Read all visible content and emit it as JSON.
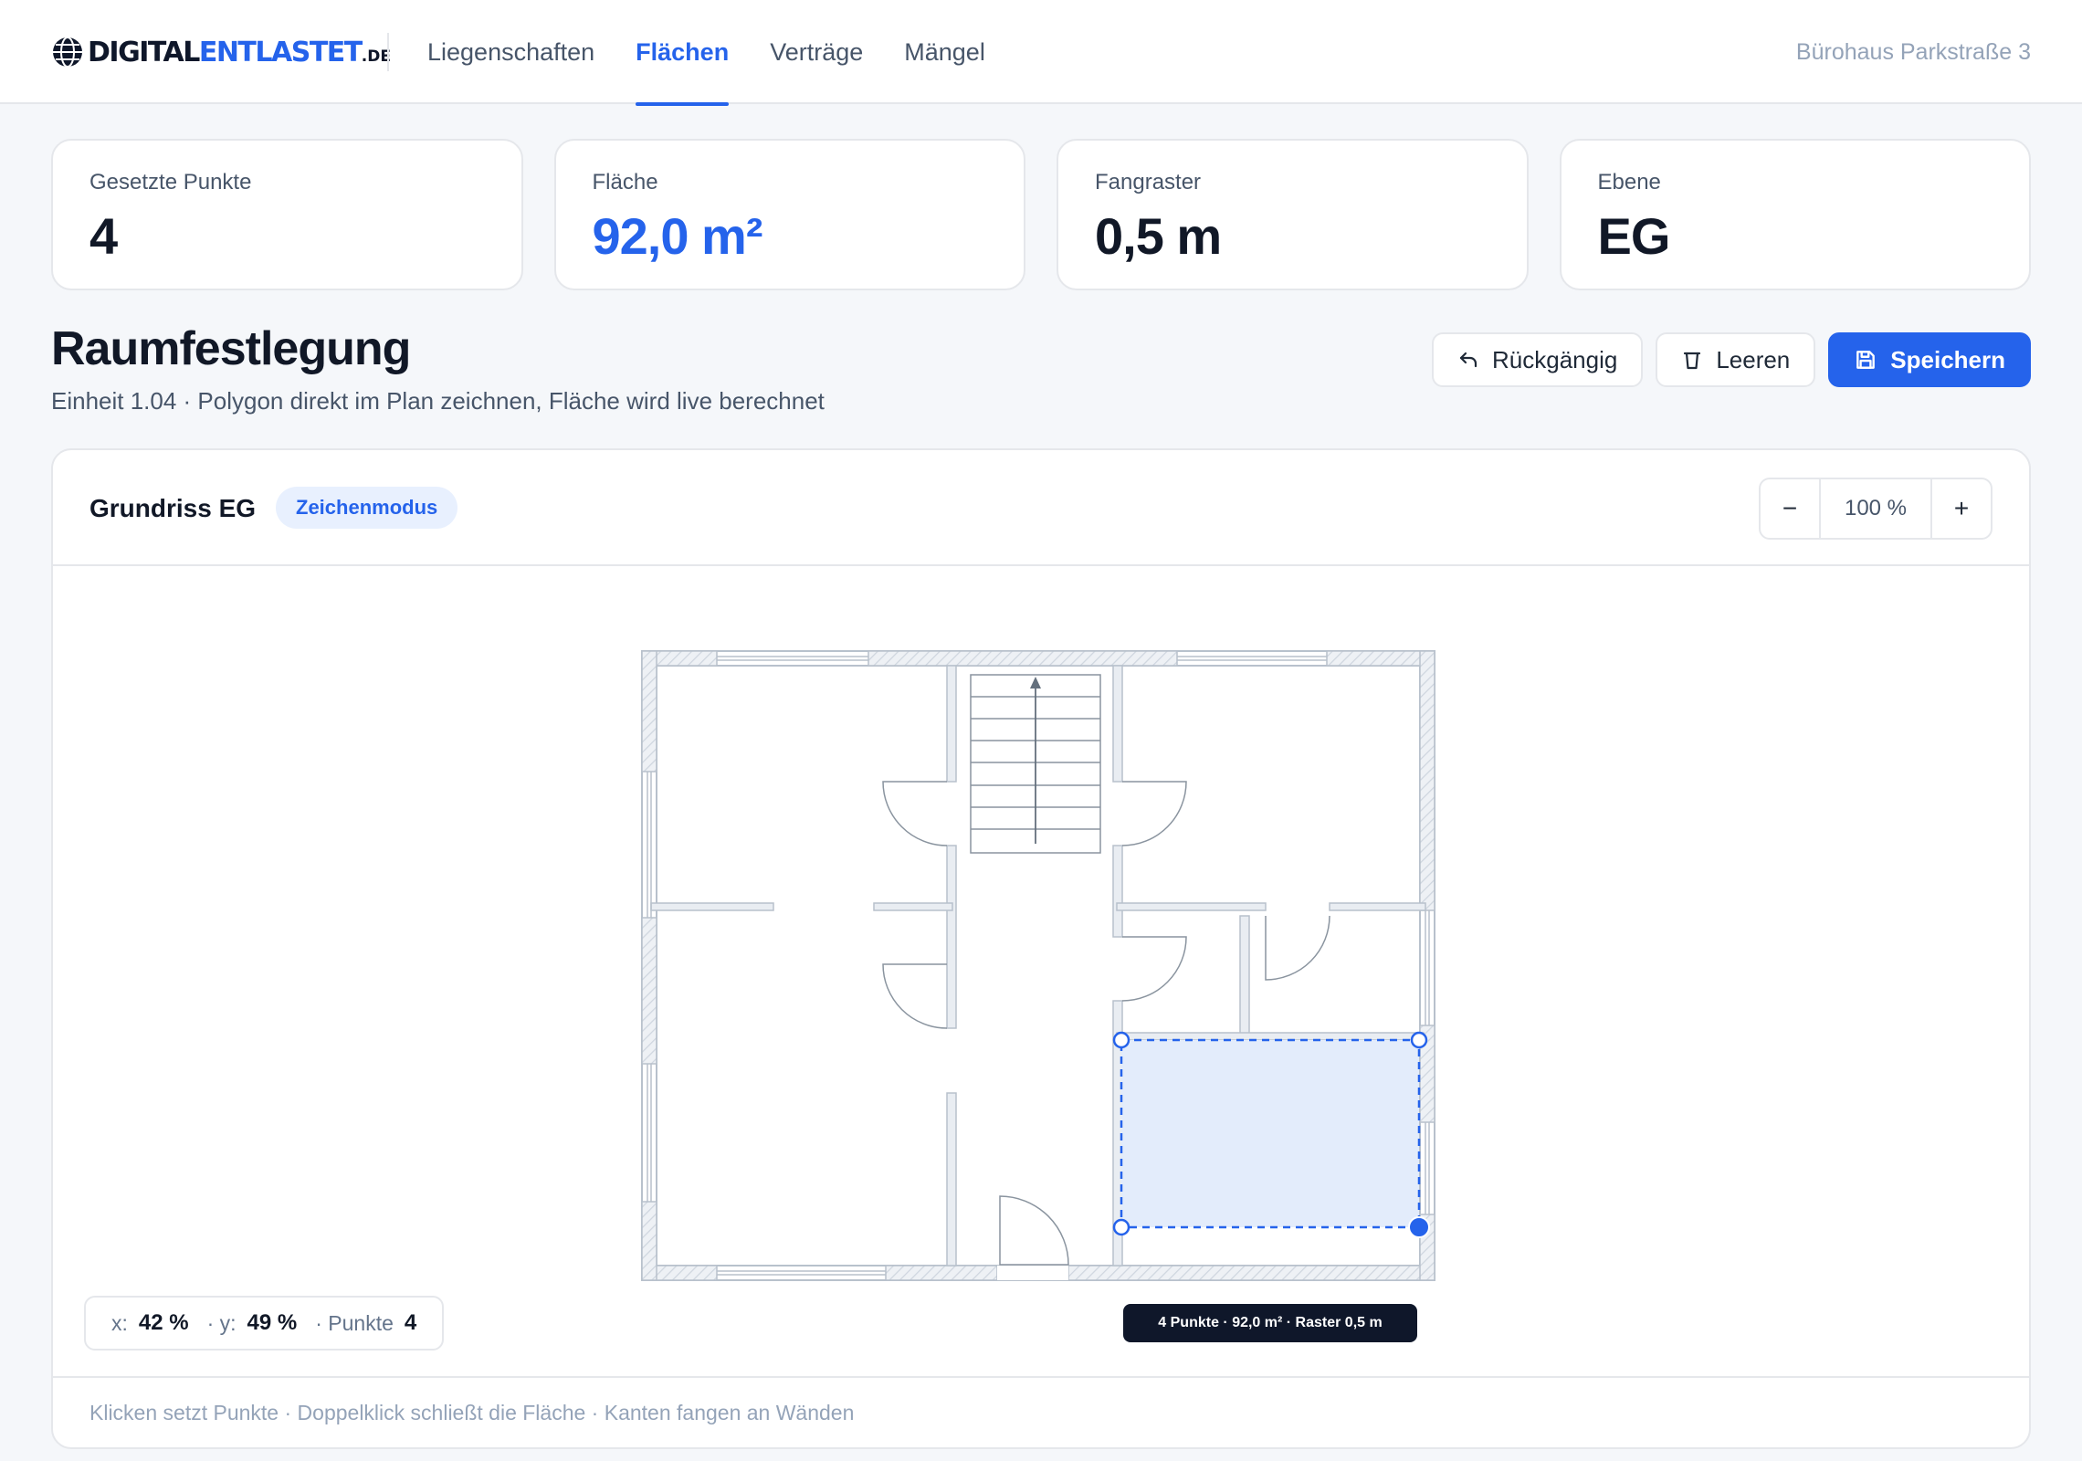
{
  "brand": {
    "part1": "DIGITAL",
    "part2": "ENTLASTET",
    "tld": ".DE"
  },
  "nav": {
    "items": [
      {
        "label": "Liegenschaften"
      },
      {
        "label": "Flächen"
      },
      {
        "label": "Verträge"
      },
      {
        "label": "Mängel"
      }
    ],
    "active": "Flächen",
    "property": "Bürohaus Parkstraße 3"
  },
  "stats": [
    {
      "label": "Gesetzte Punkte",
      "value": "4"
    },
    {
      "label": "Fläche",
      "value": "92,0 m²"
    },
    {
      "label": "Fangraster",
      "value": "0,5 m"
    },
    {
      "label": "Ebene",
      "value": "EG"
    }
  ],
  "page": {
    "title": "Raumfestlegung",
    "subtitle": "Einheit 1.04 · Polygon direkt im Plan zeichnen, Fläche wird live berechnet"
  },
  "actions": {
    "undo": "Rückgängig",
    "clear": "Leeren",
    "save": "Speichern"
  },
  "plan": {
    "title": "Grundriss EG",
    "mode": "Zeichenmodus",
    "zoom": {
      "minus": "−",
      "value": "100 %",
      "plus": "+"
    },
    "coords": {
      "x_label": "x:",
      "x_value": "42 %",
      "y_label": "· y:",
      "y_value": "49 %",
      "points_label": "· Punkte",
      "points_value": "4"
    },
    "tooltip": "4 Punkte · 92,0 m² · Raster 0,5 m",
    "hint": "Klicken setzt Punkte · Doppelklick schließt die Fläche · Kanten fangen an Wänden"
  },
  "colors": {
    "accent": "#2563eb",
    "selection_fill": "#e3ecfb",
    "wall": "#cbd5e1",
    "text": "#111827"
  },
  "icons": {
    "undo": "undo-arrow-icon",
    "clear": "trash-icon",
    "save": "floppy-disk-icon",
    "logo": "globe-icon"
  }
}
